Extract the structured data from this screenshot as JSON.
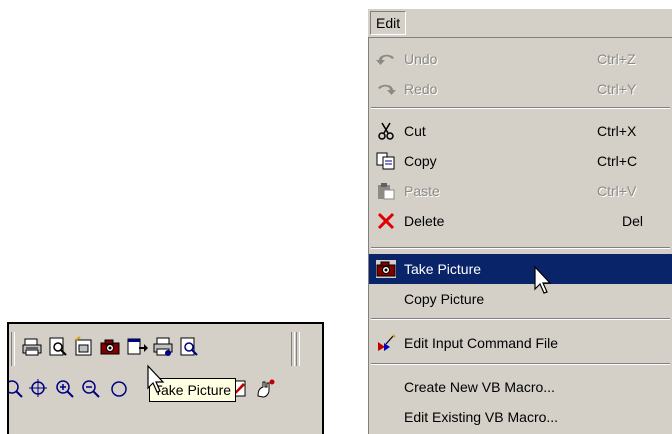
{
  "toolbar": {
    "tooltip": "Take Picture",
    "row1_icons": [
      "print-icon",
      "print-preview-icon",
      "page-setup-icon",
      "take-picture-icon",
      "export-icon",
      "print-setup-icon",
      "print-preview-2-icon"
    ],
    "row2_icons": [
      "zoom-fit-icon",
      "zoom-in-icon",
      "zoom-out-icon",
      "zoom-window-icon",
      "draw-icon",
      "pan-icon"
    ]
  },
  "menu": {
    "title": "Edit",
    "items": [
      {
        "label": "Undo",
        "shortcut": "Ctrl+Z",
        "icon": "undo-icon",
        "enabled": false
      },
      {
        "label": "Redo",
        "shortcut": "Ctrl+Y",
        "icon": "redo-icon",
        "enabled": false
      },
      {
        "label": "Cut",
        "shortcut": "Ctrl+X",
        "icon": "scissors-icon",
        "enabled": true
      },
      {
        "label": "Copy",
        "shortcut": "Ctrl+C",
        "icon": "copy-icon",
        "enabled": true
      },
      {
        "label": "Paste",
        "shortcut": "Ctrl+V",
        "icon": "paste-icon",
        "enabled": false
      },
      {
        "label": "Delete",
        "shortcut": "Del",
        "icon": "delete-x-icon",
        "enabled": true
      },
      {
        "label": "Take Picture",
        "shortcut": "",
        "icon": "camera-icon",
        "enabled": true,
        "highlighted": true
      },
      {
        "label": "Copy Picture",
        "shortcut": "",
        "icon": "",
        "enabled": true
      },
      {
        "label": "Edit Input Command File",
        "shortcut": "",
        "icon": "edit-command-file-icon",
        "enabled": true
      },
      {
        "label": "Create New VB Macro...",
        "shortcut": "",
        "icon": "",
        "enabled": true
      },
      {
        "label": "Edit Existing VB Macro...",
        "shortcut": "",
        "icon": "",
        "enabled": true
      }
    ]
  },
  "colors": {
    "face": "#d4d0c8",
    "highlight": "#0a246a",
    "tooltip_bg": "#ffffe1",
    "disabled_text": "#8c8a86"
  }
}
